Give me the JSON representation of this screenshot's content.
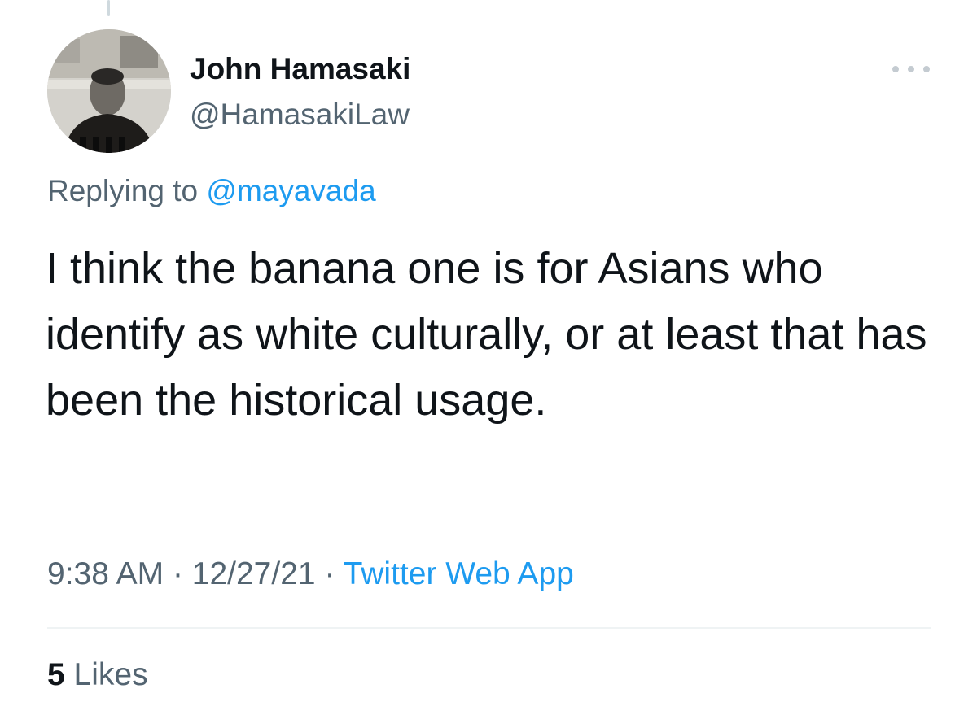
{
  "tweet": {
    "author": {
      "display_name": "John Hamasaki",
      "handle": "@HamasakiLaw",
      "avatar": "profile-photo"
    },
    "more_icon": "ellipsis-icon",
    "reply_context": {
      "prefix": "Replying to",
      "mention": "@mayavada"
    },
    "text": "I think the banana one is for Asians who identify as white culturally, or at least that has been the historical usage.",
    "meta": {
      "time": "9:38 AM",
      "separator": "·",
      "date": "12/27/21",
      "source": "Twitter Web App"
    },
    "stats": {
      "likes_count": "5",
      "likes_label": "Likes"
    }
  },
  "colors": {
    "text_primary": "#0f1419",
    "text_secondary": "#536471",
    "link": "#1d9bf0",
    "divider": "#eff3f4",
    "background": "#ffffff"
  }
}
